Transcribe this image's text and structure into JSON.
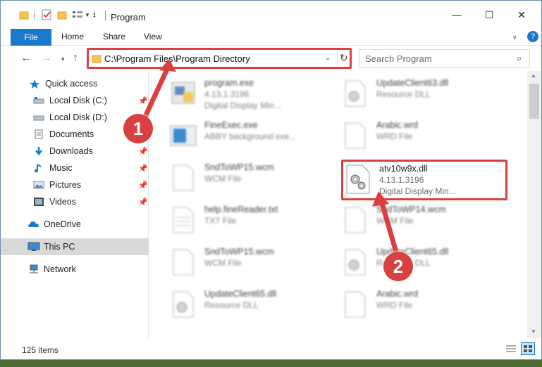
{
  "window": {
    "title": "Program",
    "minimize_glyph": "—",
    "maximize_glyph": "☐",
    "close_glyph": "✕"
  },
  "ribbon": {
    "file": "File",
    "home": "Home",
    "share": "Share",
    "view": "View"
  },
  "address": {
    "path": "C:\\Program Files\\Program Directory",
    "search_placeholder": "Search Program"
  },
  "sidebar": {
    "items": [
      {
        "label": "Quick access",
        "icon": "star-icon"
      },
      {
        "label": "Local Disk (C:)",
        "icon": "drive-icon",
        "pinned": true
      },
      {
        "label": "Local Disk (D:)",
        "icon": "drive-icon"
      },
      {
        "label": "Documents",
        "icon": "documents-icon"
      },
      {
        "label": "Downloads",
        "icon": "downloads-icon",
        "pinned": true
      },
      {
        "label": "Music",
        "icon": "music-icon",
        "pinned": true
      },
      {
        "label": "Pictures",
        "icon": "pictures-icon",
        "pinned": true
      },
      {
        "label": "Videos",
        "icon": "videos-icon",
        "pinned": true
      },
      {
        "label": "OneDrive",
        "icon": "onedrive-icon"
      },
      {
        "label": "This PC",
        "icon": "computer-icon",
        "selected": true
      },
      {
        "label": "Network",
        "icon": "network-icon"
      }
    ]
  },
  "files": [
    {
      "name": "program.exe",
      "line1": "4.13.1.3196",
      "line2": "Digital Display Min...",
      "blurred": true
    },
    {
      "name": "UpdateClient63.dll",
      "line1": "Resource DLL",
      "line2": "",
      "blurred": true
    },
    {
      "name": "FineExec.exe",
      "line1": "ABBY background exe...",
      "line2": "",
      "blurred": true
    },
    {
      "name": "Arabic.wrd",
      "line1": "WRD File",
      "line2": "",
      "blurred": true
    },
    {
      "name": "SndToWP15.wcm",
      "line1": "WCM File",
      "line2": "",
      "blurred": true
    },
    {
      "name": "atv10w9x.dll",
      "line1": "4.13.1.3196",
      "line2": "Digital Display Min...",
      "blurred": false
    },
    {
      "name": "help.fineReader.txt",
      "line1": "TXT File",
      "line2": "",
      "blurred": true
    },
    {
      "name": "SndToWP14.wcm",
      "line1": "WCM File",
      "line2": "",
      "blurred": true
    },
    {
      "name": "SndToWP15.wcm",
      "line1": "WCM File",
      "line2": "",
      "blurred": true
    },
    {
      "name": "UpdateClient65.dll",
      "line1": "Resource DLL",
      "line2": "",
      "blurred": true
    },
    {
      "name": "UpdateClient65.dll",
      "line1": "Resource DLL",
      "line2": "",
      "blurred": true
    },
    {
      "name": "Arabic.wrd",
      "line1": "WRD File",
      "line2": "",
      "blurred": true
    }
  ],
  "status": {
    "item_count": "125 items"
  },
  "annotations": {
    "step1": "1",
    "step2": "2",
    "color": "#d8413f"
  }
}
